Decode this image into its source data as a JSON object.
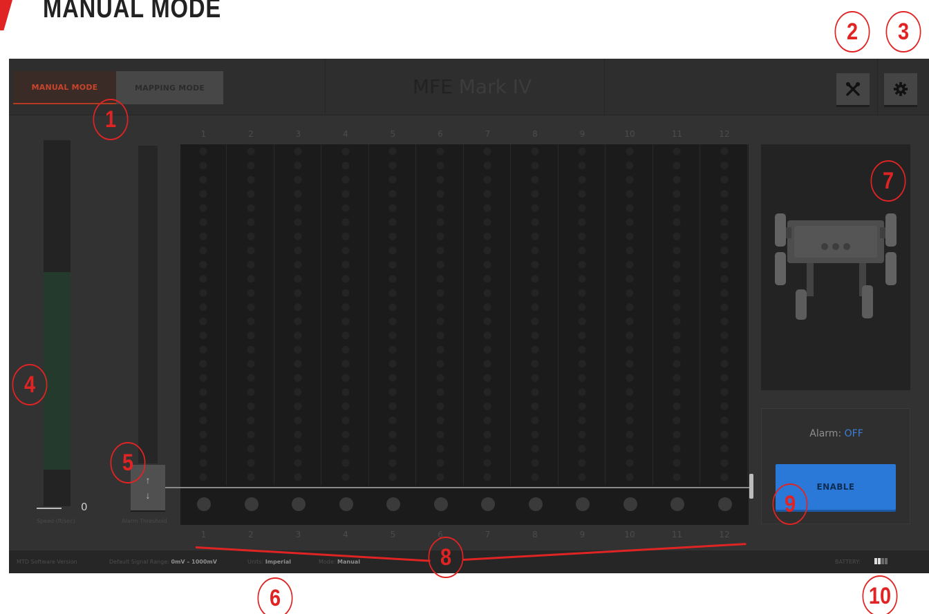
{
  "document": {
    "heading": "MANUAL MODE"
  },
  "callouts": [
    "1",
    "2",
    "3",
    "4",
    "5",
    "6",
    "7",
    "8",
    "9",
    "10"
  ],
  "app": {
    "modes": {
      "manual": "MANUAL MODE",
      "mapping": "MAPPING MODE",
      "active": "manual"
    },
    "title": {
      "main": "MFE",
      "sub": "Mark IV"
    },
    "toolbar": {
      "tools_icon": "tools-icon",
      "settings_icon": "gear-icon"
    }
  },
  "speed": {
    "value": "0",
    "label": "Speed (ft/sec)",
    "level": 0.54
  },
  "threshold": {
    "label": "Alarm Threshold",
    "up_icon": "arrow-up-icon",
    "down_icon": "arrow-down-icon"
  },
  "grid": {
    "columns_top": [
      "1",
      "2",
      "3",
      "4",
      "5",
      "6",
      "7",
      "8",
      "9",
      "10",
      "11",
      "12"
    ],
    "columns_bottom": [
      "1",
      "2",
      "3",
      "4",
      "5",
      "6",
      "7",
      "8",
      "9",
      "10",
      "11",
      "12"
    ]
  },
  "alarm": {
    "label": "Alarm:",
    "value": "OFF",
    "button": "ENABLE"
  },
  "status_bar": {
    "version_label": "MTD Software Version",
    "signal_label": "Default Signal Range:",
    "signal_value": "0mV – 1000mV",
    "units_label": "Units:",
    "units_value": "Imperial",
    "mode_label": "Mode:",
    "mode_value": "Manual",
    "battery_label": "BATTERY:",
    "battery_level": 0.5
  },
  "colors": {
    "callout_red": "#e02424",
    "accent_blue": "#2a79d8",
    "manual_active": "#c8442c",
    "speed_green": "#243a2c"
  }
}
